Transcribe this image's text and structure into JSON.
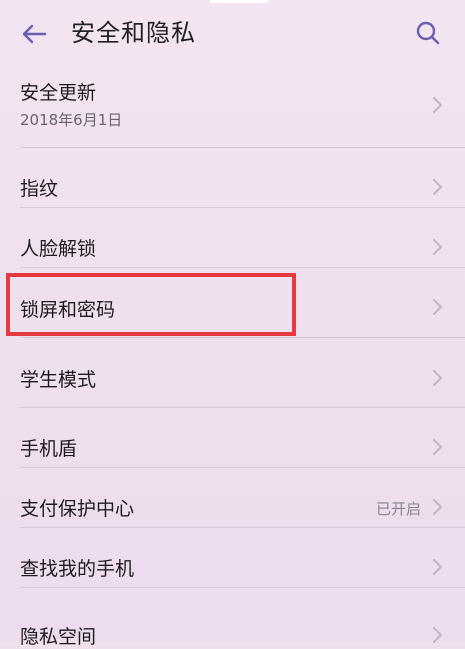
{
  "header": {
    "title": "安全和隐私",
    "back_icon": "arrow-left-icon",
    "search_icon": "search-icon"
  },
  "items": [
    {
      "label": "安全更新",
      "sub": "2018年6月1日",
      "status": ""
    },
    {
      "label": "指纹",
      "sub": "",
      "status": ""
    },
    {
      "label": "人脸解锁",
      "sub": "",
      "status": ""
    },
    {
      "label": "锁屏和密码",
      "sub": "",
      "status": ""
    },
    {
      "label": "学生模式",
      "sub": "",
      "status": ""
    },
    {
      "label": "手机盾",
      "sub": "",
      "status": ""
    },
    {
      "label": "支付保护中心",
      "sub": "",
      "status": "已开启"
    },
    {
      "label": "查找我的手机",
      "sub": "",
      "status": ""
    },
    {
      "label": "隐私空间",
      "sub": "",
      "status": ""
    }
  ],
  "colors": {
    "accent": "#6a5fb0",
    "highlight_border": "#e53a3f",
    "background": "#efe0ee"
  }
}
